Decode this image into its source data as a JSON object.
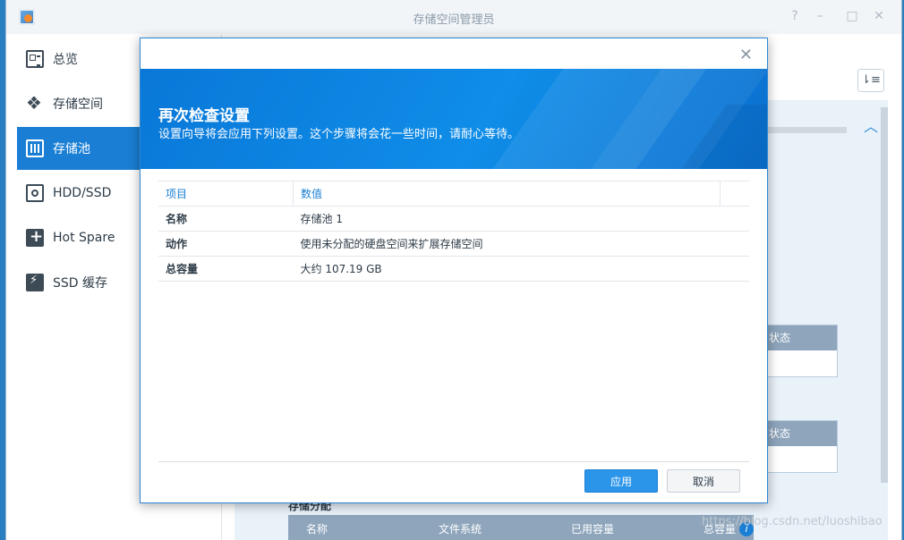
{
  "window": {
    "title": "存储空间管理员"
  },
  "sidebar": {
    "items": [
      {
        "label": "总览",
        "icon": "overview-icon",
        "active": false
      },
      {
        "label": "存储空间",
        "icon": "volume-icon",
        "active": false
      },
      {
        "label": "存储池",
        "icon": "storage-pool-icon",
        "active": true
      },
      {
        "label": "HDD/SSD",
        "icon": "hdd-icon",
        "active": false
      },
      {
        "label": "Hot Spare",
        "icon": "hot-spare-icon",
        "active": false
      },
      {
        "label": "SSD 缓存",
        "icon": "ssd-cache-icon",
        "active": false
      }
    ]
  },
  "background": {
    "status_label_1": "状态",
    "status_label_2": "状态",
    "pool_section_label": "存储分配",
    "bottom_table_headers": [
      "名称",
      "文件系统",
      "已用容量",
      "总容量"
    ],
    "watermark": "https://blog.csdn.net/luoshibao"
  },
  "dialog": {
    "title": "再次检查设置",
    "subtitle": "设置向导将会应用下列设置。这个步骤将会花一些时间，请耐心等待。",
    "table": {
      "headers": [
        "项目",
        "数值"
      ],
      "rows": [
        {
          "key": "名称",
          "value": "存储池 1"
        },
        {
          "key": "动作",
          "value": "使用未分配的硬盘空间来扩展存储空间"
        },
        {
          "key": "总容量",
          "value": "大约 107.19 GB"
        }
      ]
    },
    "buttons": {
      "apply": "应用",
      "cancel": "取消"
    }
  },
  "colors": {
    "accent": "#1a7fd4",
    "banner": "#0f8de8"
  }
}
